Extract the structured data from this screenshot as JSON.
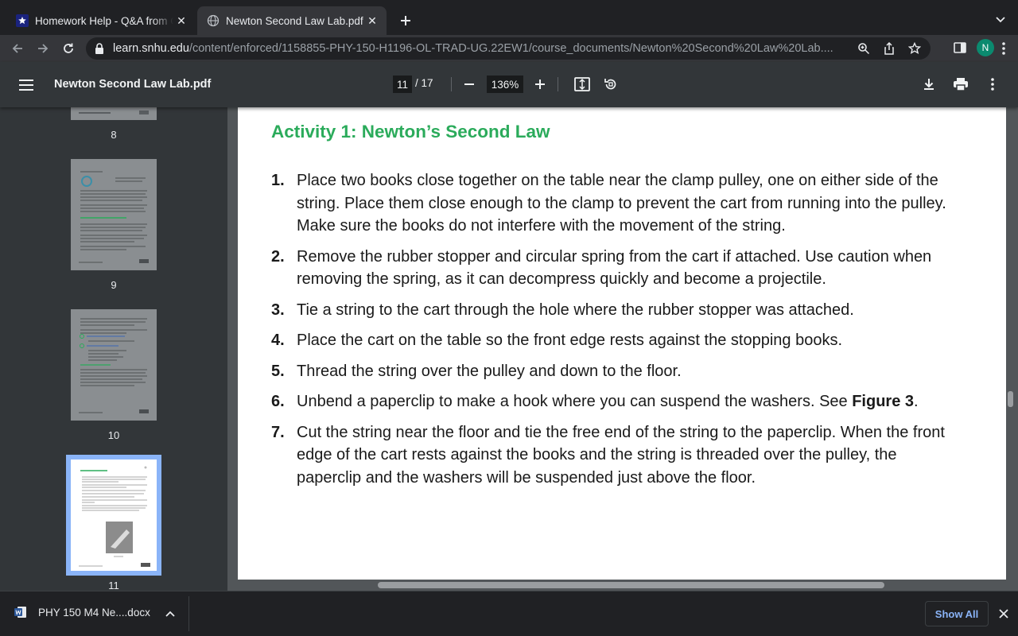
{
  "browser": {
    "tabs": [
      {
        "title": "Homework Help - Q&A from Online Tutors - Course Hero",
        "active": false
      },
      {
        "title": "Newton Second Law Lab.pdf",
        "active": true
      }
    ],
    "url_host": "learn.snhu.edu",
    "url_path": "/content/enforced/1158855-PHY-150-H1196-OL-TRAD-UG.22EW1/course_documents/Newton%20Second%20Law%20Lab....",
    "profile_initial": "N",
    "profile_color": "#0b8a6f"
  },
  "pdf_toolbar": {
    "title": "Newton Second Law Lab.pdf",
    "current_page": "11",
    "page_separator": "/ 17",
    "zoom": "136%"
  },
  "thumbnails": [
    {
      "number": "8"
    },
    {
      "number": "9"
    },
    {
      "number": "10"
    },
    {
      "number": "11",
      "selected": true
    }
  ],
  "document": {
    "heading": "Activity 1: Newton’s Second Law",
    "steps": [
      {
        "num": "1.",
        "text": "Place two books close together on the table near the clamp pulley, one on either side of the string. Place them close enough to the clamp to prevent the cart from running into the pulley.  Make sure the books do not interfere with the movement of the string."
      },
      {
        "num": "2.",
        "text": "Remove the rubber stopper and circular spring from the cart if attached.  Use caution when removing the spring, as it can decompress quickly and become a projectile."
      },
      {
        "num": "3.",
        "text": "Tie a string to the cart through the hole where the rubber stopper was attached."
      },
      {
        "num": "4.",
        "text": "Place the cart on the table so the front edge rests against the stopping books."
      },
      {
        "num": "5.",
        "text": "Thread the string over the pulley and down to the floor."
      },
      {
        "num": "6.",
        "text": "Unbend a paperclip to make a hook where you can suspend the washers.  See ",
        "bold": "Figure 3",
        "after": "."
      },
      {
        "num": "7.",
        "text": "Cut the string near the floor and tie the free end of the string to the paperclip. When the front edge of the cart rests against the books and the string is threaded over the pulley, the paperclip and the washers will be suspended just above the floor."
      }
    ],
    "heading_color": "#2bab5b"
  },
  "download_shelf": {
    "file_name": "PHY 150 M4 Ne....docx",
    "show_all": "Show All"
  }
}
